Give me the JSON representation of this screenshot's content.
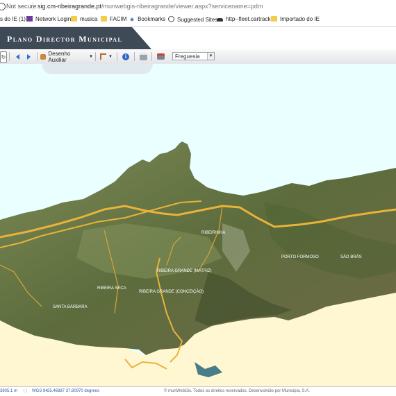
{
  "browser": {
    "security": "Not secure",
    "url_host": "sig.cm-ribeiragrande.pt",
    "url_path": "/munwebgis-ribeiragrande/viewer.aspx?servicename=pdm"
  },
  "bookmarks": [
    {
      "label": "s do IE (1)",
      "icon": "folder"
    },
    {
      "label": "Network Login",
      "icon": "purple-square"
    },
    {
      "label": "musica",
      "icon": "folder"
    },
    {
      "label": "FACIM",
      "icon": "folder"
    },
    {
      "label": "Bookmarks",
      "icon": "star"
    },
    {
      "label": "Suggested Sites",
      "icon": "globe"
    },
    {
      "label": "http--fleet.cartrack",
      "icon": "car"
    },
    {
      "label": "Importado do IE",
      "icon": "folder"
    }
  ],
  "header": {
    "title": "Plano Director Municipal"
  },
  "toolbar": {
    "desenho_label": "Desenho Auxiliar",
    "freguesia_value": "Freguesia"
  },
  "map": {
    "labels": [
      "RIBEIRINHA",
      "RIBEIRA GRANDE (MATRIZ)",
      "RIBEIRA GRANDE (CONCEIÇÃO)",
      "RIBEIRA SECA",
      "SANTA BÁRBARA",
      "PORTO FORMOSO",
      "SÃO BRÁS"
    ]
  },
  "status": {
    "scale": "3805.1 m",
    "crs": "WGS 84",
    "coords": "-25.46887  37.80970 degrees",
    "footer": "© munWebGis. Todos os direitos reservados. Desenvolvido por Municipia, S.A."
  },
  "colors": {
    "header_band": "#3f4a57",
    "sky": "#eaffff",
    "sea": "#fff6d2",
    "road": "#e8b33a",
    "land": "#6c7a45"
  }
}
